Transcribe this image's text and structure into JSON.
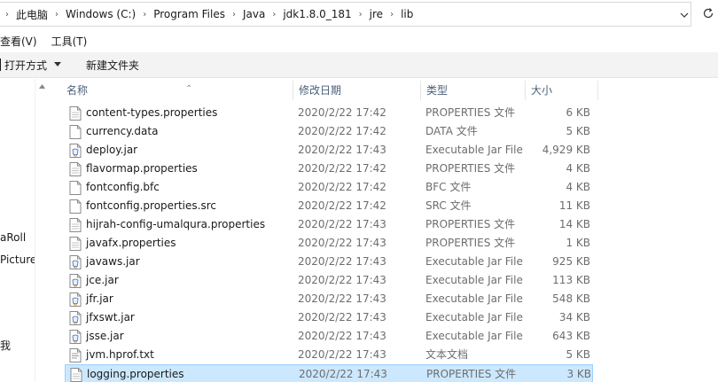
{
  "address": {
    "crumbs": [
      "此电脑",
      "Windows (C:)",
      "Program Files",
      "Java",
      "jdk1.8.0_181",
      "jre",
      "lib"
    ]
  },
  "menu": {
    "view": "查看(V)",
    "tools": "工具(T)"
  },
  "toolbar": {
    "open_with": "打开方式",
    "new_folder": "新建文件夹"
  },
  "nav": {
    "items": [
      "aRoll",
      "Pictures",
      "我"
    ]
  },
  "columns": {
    "name": "名称",
    "date": "修改日期",
    "type": "类型",
    "size": "大小"
  },
  "files": [
    {
      "name": "content-types.properties",
      "date": "2020/2/22 17:42",
      "type": "PROPERTIES 文件",
      "size": "6 KB",
      "icon": "properties-file-icon"
    },
    {
      "name": "currency.data",
      "date": "2020/2/22 17:42",
      "type": "DATA 文件",
      "size": "5 KB",
      "icon": "blank-file-icon"
    },
    {
      "name": "deploy.jar",
      "date": "2020/2/22 17:43",
      "type": "Executable Jar File",
      "size": "4,929 KB",
      "icon": "jar-file-icon"
    },
    {
      "name": "flavormap.properties",
      "date": "2020/2/22 17:42",
      "type": "PROPERTIES 文件",
      "size": "4 KB",
      "icon": "properties-file-icon"
    },
    {
      "name": "fontconfig.bfc",
      "date": "2020/2/22 17:42",
      "type": "BFC 文件",
      "size": "4 KB",
      "icon": "blank-file-icon"
    },
    {
      "name": "fontconfig.properties.src",
      "date": "2020/2/22 17:42",
      "type": "SRC 文件",
      "size": "11 KB",
      "icon": "blank-file-icon"
    },
    {
      "name": "hijrah-config-umalqura.properties",
      "date": "2020/2/22 17:43",
      "type": "PROPERTIES 文件",
      "size": "14 KB",
      "icon": "properties-file-icon"
    },
    {
      "name": "javafx.properties",
      "date": "2020/2/22 17:43",
      "type": "PROPERTIES 文件",
      "size": "1 KB",
      "icon": "properties-file-icon"
    },
    {
      "name": "javaws.jar",
      "date": "2020/2/22 17:43",
      "type": "Executable Jar File",
      "size": "925 KB",
      "icon": "jar-file-icon"
    },
    {
      "name": "jce.jar",
      "date": "2020/2/22 17:43",
      "type": "Executable Jar File",
      "size": "113 KB",
      "icon": "jar-file-icon"
    },
    {
      "name": "jfr.jar",
      "date": "2020/2/22 17:43",
      "type": "Executable Jar File",
      "size": "548 KB",
      "icon": "jar-file-icon"
    },
    {
      "name": "jfxswt.jar",
      "date": "2020/2/22 17:43",
      "type": "Executable Jar File",
      "size": "34 KB",
      "icon": "jar-file-icon"
    },
    {
      "name": "jsse.jar",
      "date": "2020/2/22 17:43",
      "type": "Executable Jar File",
      "size": "643 KB",
      "icon": "jar-file-icon"
    },
    {
      "name": "jvm.hprof.txt",
      "date": "2020/2/22 17:43",
      "type": "文本文档",
      "size": "5 KB",
      "icon": "text-file-icon"
    },
    {
      "name": "logging.properties",
      "date": "2020/2/22 17:43",
      "type": "PROPERTIES 文件",
      "size": "3 KB",
      "icon": "properties-file-icon",
      "selected": true
    }
  ],
  "colors": {
    "selection_bg": "#cce8ff",
    "selection_border": "#99d1ff",
    "header_text": "#4c607a",
    "toolbar_bg": "#f3f3f3"
  }
}
